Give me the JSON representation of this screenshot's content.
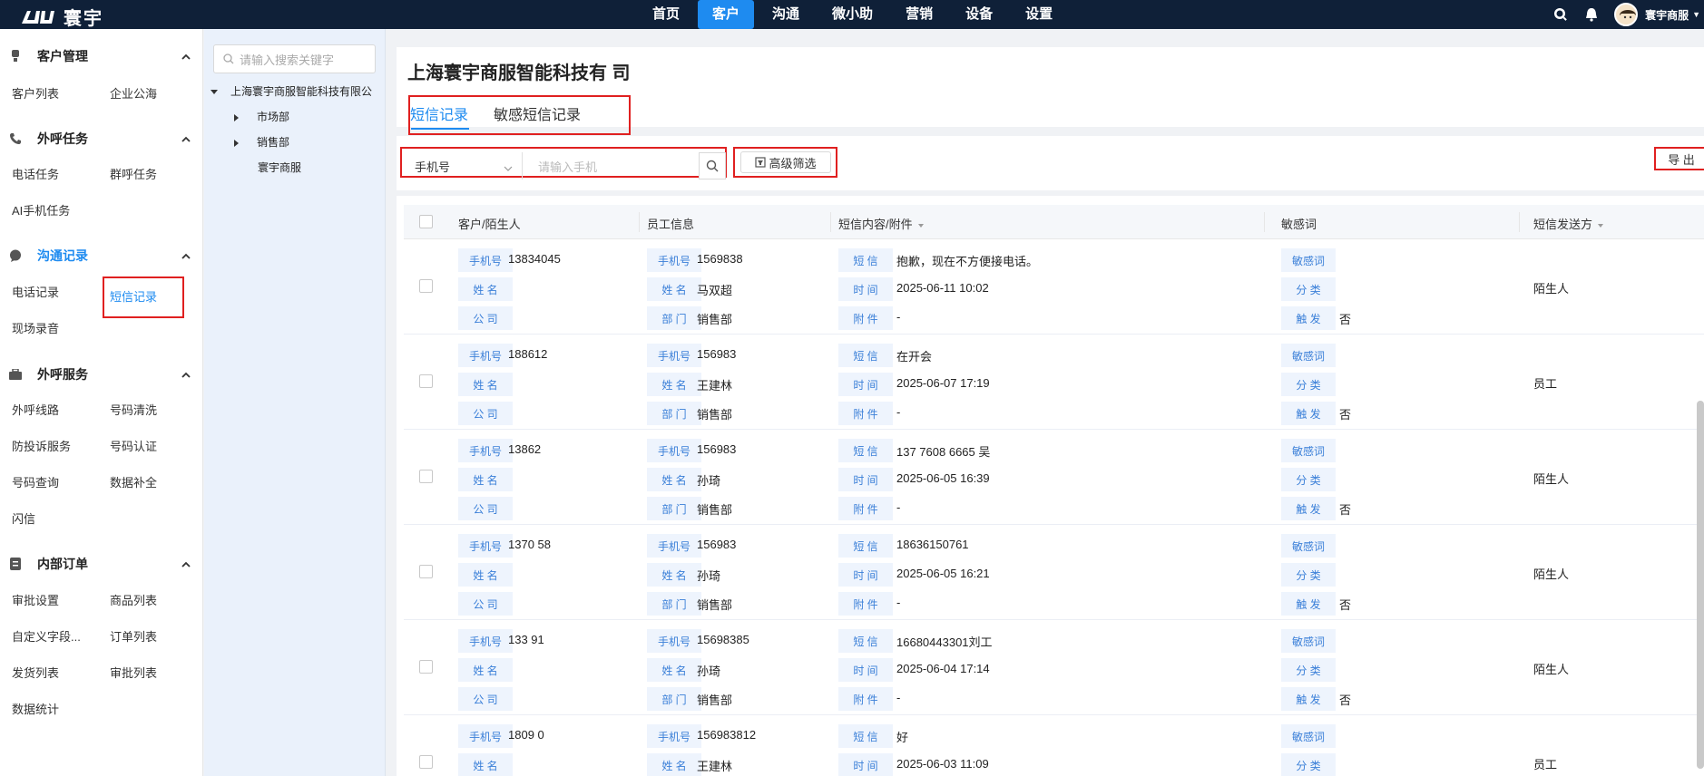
{
  "app": {
    "name": "寰宇"
  },
  "topnav": {
    "items": [
      "首页",
      "客户",
      "沟通",
      "微小助",
      "营销",
      "设备",
      "设置"
    ],
    "active": "客户",
    "user_name": "寰宇商服"
  },
  "sidebar": {
    "sections": [
      {
        "title": "客户管理",
        "links": [
          "客户列表",
          "企业公海"
        ]
      },
      {
        "title": "外呼任务",
        "links": [
          "电话任务",
          "群呼任务",
          "AI手机任务"
        ]
      },
      {
        "title": "沟通记录",
        "links": [
          "电话记录",
          "短信记录",
          "现场录音"
        ]
      },
      {
        "title": "外呼服务",
        "links": [
          "外呼线路",
          "号码清洗",
          "防投诉服务",
          "号码认证",
          "号码查询",
          "数据补全",
          "闪信"
        ]
      },
      {
        "title": "内部订单",
        "links": [
          "审批设置",
          "商品列表",
          "自定义字段...",
          "订单列表",
          "发货列表",
          "审批列表",
          "数据统计"
        ]
      }
    ],
    "active_link": "短信记录"
  },
  "tree": {
    "search_placeholder": "请输入搜索关键字",
    "root": "上海寰宇商服智能科技有限公",
    "children": [
      "市场部",
      "销售部",
      "寰宇商服"
    ]
  },
  "main": {
    "company_title": "上海寰宇商服智能科技有 司",
    "tabs": [
      "短信记录",
      "敏感短信记录"
    ],
    "filter": {
      "select_value": "手机号",
      "search_placeholder": "请输入手机",
      "advanced_label": "高级筛选",
      "export_label": "导 出"
    },
    "columns": [
      "客户/陌生人",
      "员工信息",
      "短信内容/附件",
      "敏感词",
      "短信发送方"
    ],
    "labels": {
      "phone": "手机号",
      "name": "姓 名",
      "company": "公 司",
      "dept": "部 门",
      "sms": "短 信",
      "time": "时 间",
      "attach": "附 件",
      "sensitive": "敏感词",
      "category": "分 类",
      "trigger": "触 发"
    },
    "rows": [
      {
        "customer_phone": "13834045",
        "emp_phone": "1569838",
        "emp_name": "马双超",
        "emp_dept": "销售部",
        "sms": "抱歉，现在不方便接电话。",
        "time": "2025-06-11 10:02",
        "attach": "-",
        "trigger": "否",
        "sender": "陌生人"
      },
      {
        "customer_phone": "188612",
        "emp_phone": "156983",
        "emp_name": "王建林",
        "emp_dept": "销售部",
        "sms": "在开会",
        "time": "2025-06-07 17:19",
        "attach": "-",
        "trigger": "否",
        "sender": "员工"
      },
      {
        "customer_phone": "13862",
        "emp_phone": "156983",
        "emp_name": "孙琦",
        "emp_dept": "销售部",
        "sms": "137 7608 6665 吴",
        "time": "2025-06-05 16:39",
        "attach": "-",
        "trigger": "否",
        "sender": "陌生人"
      },
      {
        "customer_phone": "1370  58",
        "emp_phone": "156983",
        "emp_name": "孙琦",
        "emp_dept": "销售部",
        "sms": "18636150761",
        "time": "2025-06-05 16:21",
        "attach": "-",
        "trigger": "否",
        "sender": "陌生人"
      },
      {
        "customer_phone": "133  91",
        "emp_phone": "15698385",
        "emp_name": "孙琦",
        "emp_dept": "销售部",
        "sms": "16680443301刘工",
        "time": "2025-06-04 17:14",
        "attach": "-",
        "trigger": "否",
        "sender": "陌生人"
      },
      {
        "customer_phone": "1809  0",
        "emp_phone": "156983812",
        "emp_name": "王建林",
        "emp_dept": "",
        "sms": "好",
        "time": "2025-06-03 11:09",
        "attach": "",
        "trigger": "",
        "sender": "员工"
      }
    ]
  },
  "colors": {
    "topbar": "#0f2038",
    "accent": "#1e8bf0",
    "highlight_box": "#e02020",
    "tag_bg": "#eef4fd"
  }
}
